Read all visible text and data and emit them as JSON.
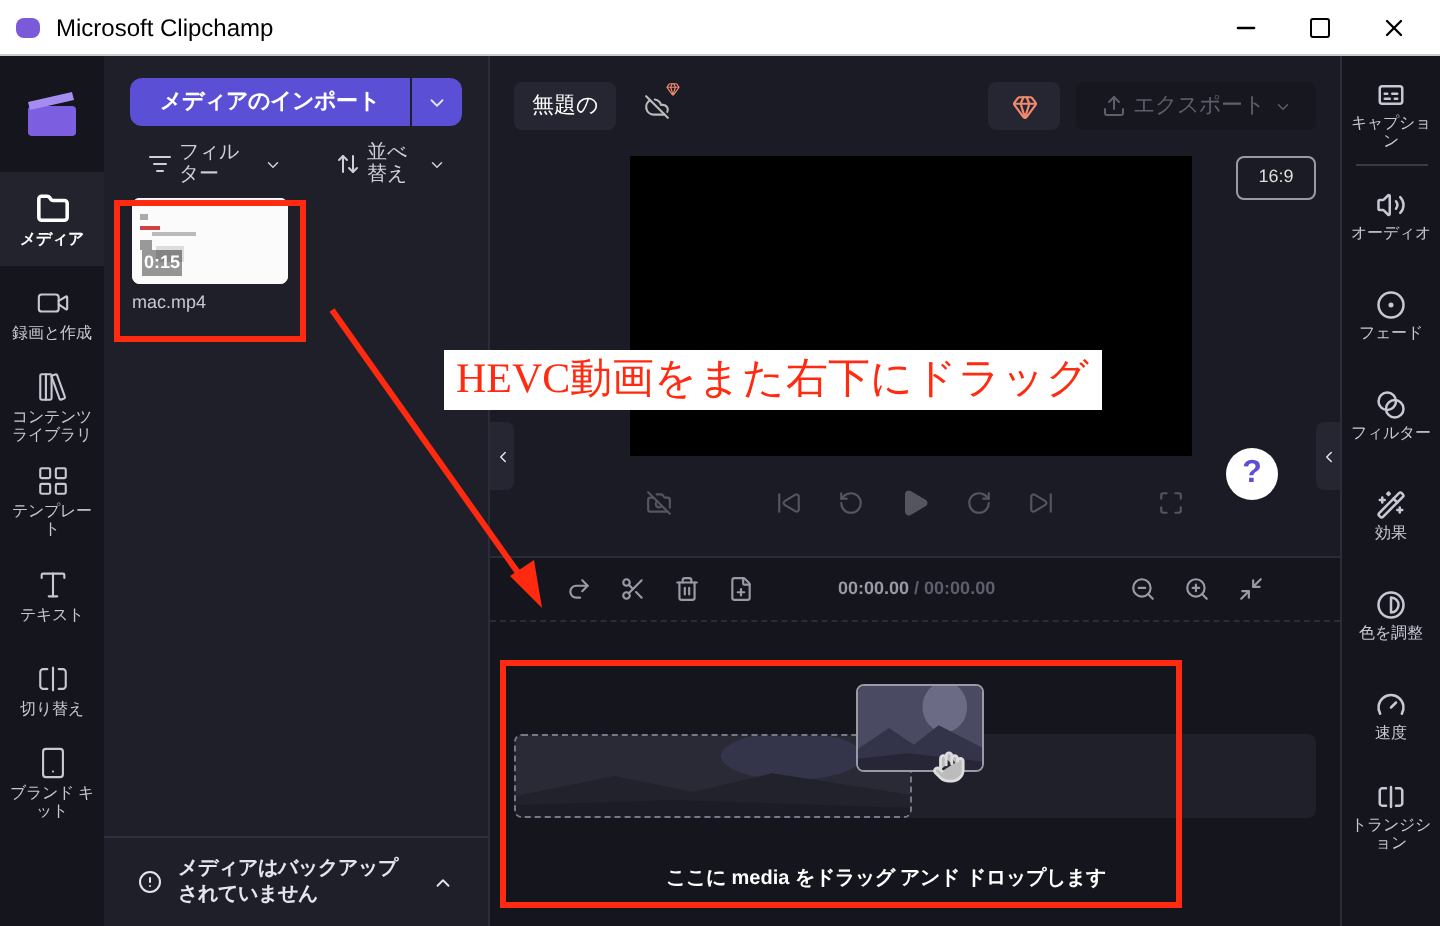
{
  "window": {
    "title": "Microsoft Clipchamp"
  },
  "left_rail": [
    {
      "label": "メディア",
      "selected": true
    },
    {
      "label": "録画と作成",
      "selected": false
    },
    {
      "label": "コンテンツライブラリ",
      "selected": false
    },
    {
      "label": "テンプレート",
      "selected": false
    },
    {
      "label": "テキスト",
      "selected": false
    },
    {
      "label": "切り替え",
      "selected": false
    },
    {
      "label": "ブランド キット",
      "selected": false
    }
  ],
  "media_panel": {
    "import_button": "メディアのインポート",
    "filter": "フィルター",
    "sort": "並べ替え",
    "items": [
      {
        "name": "mac.mp4",
        "duration": "0:15"
      }
    ],
    "backup_notice": "メディアはバックアップされていません"
  },
  "top_bar": {
    "project_title": "無題の",
    "export": {
      "label": "エクスポート",
      "disabled": true
    }
  },
  "preview": {
    "aspect_ratio": "16:9",
    "help": "?"
  },
  "timeline": {
    "current_time": "00:00.00",
    "total_time": "/ 00:00.00",
    "drop_hint": "ここに media をドラッグ アンド ドロップします"
  },
  "right_rail": [
    {
      "label": "キャプション"
    },
    {
      "label": "オーディオ"
    },
    {
      "label": "フェード"
    },
    {
      "label": "フィルター"
    },
    {
      "label": "効果"
    },
    {
      "label": "色を調整"
    },
    {
      "label": "速度"
    },
    {
      "label": "トランジション"
    }
  ],
  "annotation": {
    "callout": "HEVC動画をまた右下にドラッグ"
  }
}
